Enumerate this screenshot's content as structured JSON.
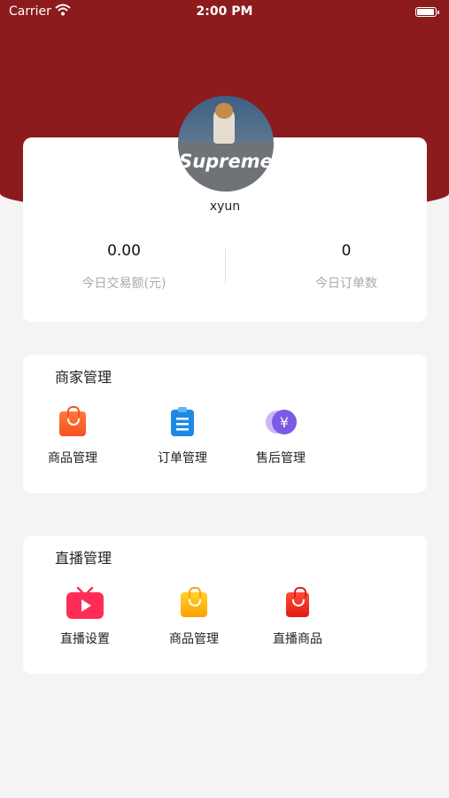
{
  "status_bar": {
    "carrier": "Carrier",
    "time": "2:00 PM",
    "battery_level": 1.0
  },
  "profile": {
    "avatar_text": "Supreme",
    "username": "xyun",
    "stats": [
      {
        "value": "0.00",
        "label": "今日交易额(元)"
      },
      {
        "value": "0",
        "label": "今日订单数"
      }
    ]
  },
  "merchant": {
    "title": "商家管理",
    "items": [
      {
        "label": "商品管理",
        "icon": "orange-shopping-bag-icon"
      },
      {
        "label": "订单管理",
        "icon": "clipboard-icon"
      },
      {
        "label": "售后管理",
        "icon": "yuan-coin-icon"
      }
    ]
  },
  "live": {
    "title": "直播管理",
    "items": [
      {
        "label": "直播设置",
        "icon": "tv-play-icon"
      },
      {
        "label": "商品管理",
        "icon": "yellow-shopping-bag-icon"
      },
      {
        "label": "直播商品",
        "icon": "red-shopping-bag-icon"
      }
    ]
  },
  "colors": {
    "header": "#8c1b1d",
    "background": "#f4f4f4",
    "card": "#ffffff"
  }
}
